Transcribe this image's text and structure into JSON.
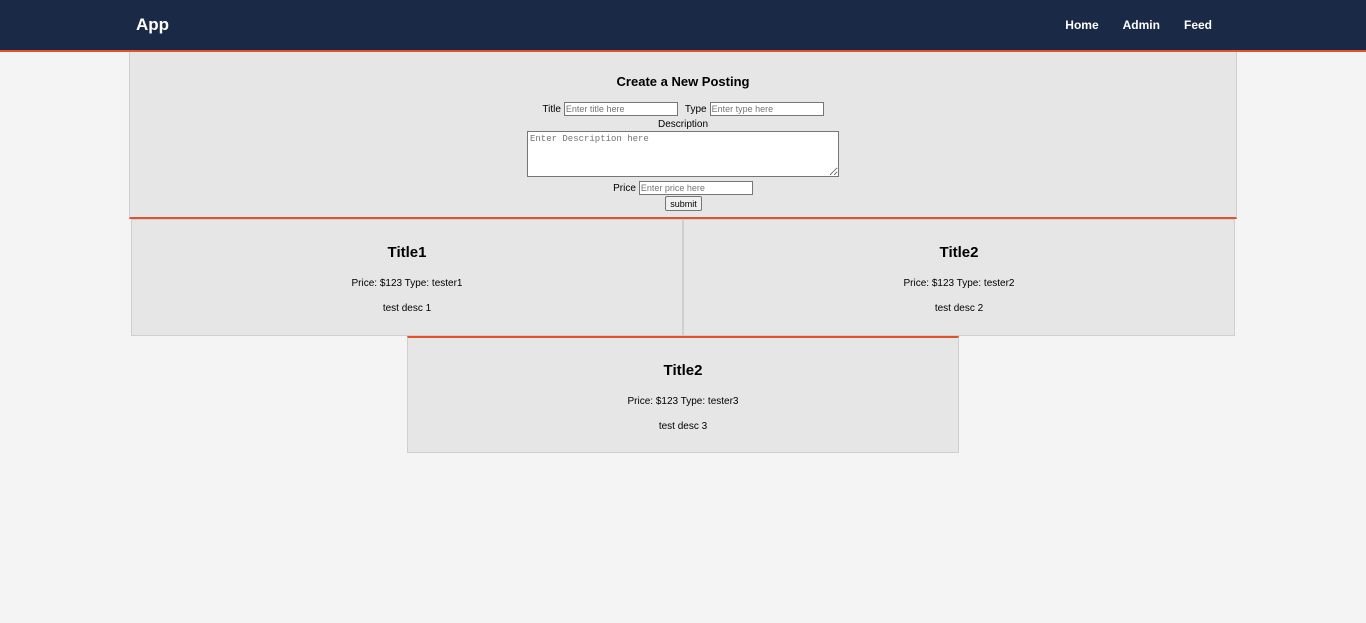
{
  "navbar": {
    "brand": "App",
    "links": [
      "Home",
      "Admin",
      "Feed"
    ]
  },
  "form": {
    "heading": "Create a New Posting",
    "title_label": "Title",
    "title_placeholder": "Enter title here",
    "type_label": "Type",
    "type_placeholder": "Enter type here",
    "description_label": "Description",
    "description_placeholder": "Enter Description here",
    "price_label": "Price",
    "price_placeholder": "Enter price here",
    "submit_label": "submit"
  },
  "postings": [
    {
      "title": "Title1",
      "meta": "Price: $123 Type: tester1",
      "description": "test desc 1"
    },
    {
      "title": "Title2",
      "meta": "Price: $123 Type: tester2",
      "description": "test desc 2"
    },
    {
      "title": "Title2",
      "meta": "Price: $123 Type: tester3",
      "description": "test desc 3"
    }
  ],
  "colors": {
    "navbar_bg": "#1a2945",
    "accent": "#e0522b",
    "panel_bg": "#e6e6e6",
    "page_bg": "#f4f4f4"
  }
}
